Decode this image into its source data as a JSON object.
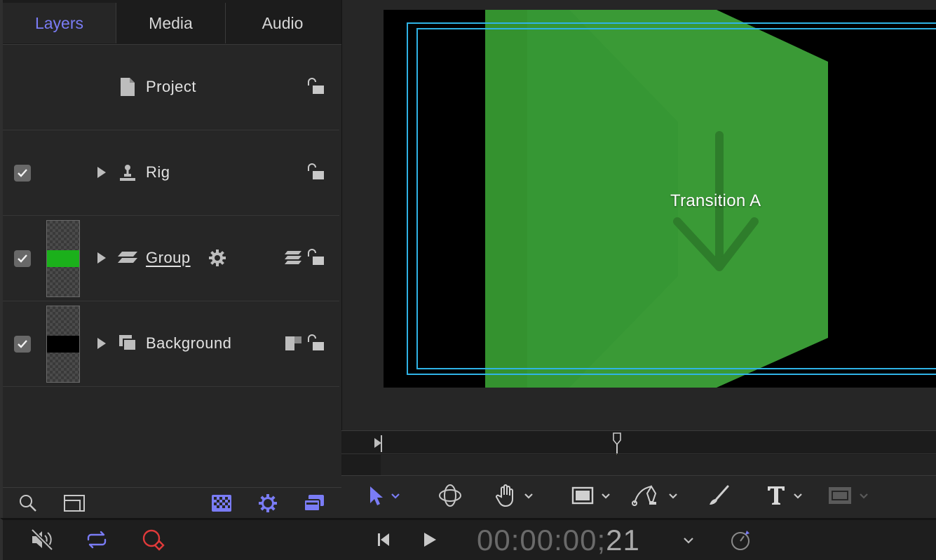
{
  "tabs": [
    {
      "label": "Layers",
      "active": true
    },
    {
      "label": "Media",
      "active": false
    },
    {
      "label": "Audio",
      "active": false
    }
  ],
  "layers": {
    "project": {
      "label": "Project",
      "icon": "document-icon"
    },
    "rig": {
      "label": "Rig",
      "icon": "rig-joystick-icon",
      "enabled": true
    },
    "group": {
      "label": "Group",
      "icon": "group-layers-icon",
      "enabled": true,
      "thumbnail_color": "#1bb01b"
    },
    "background": {
      "label": "Background",
      "icon": "stacked-squares-icon",
      "enabled": true,
      "thumbnail_color": "#000000"
    }
  },
  "canvas": {
    "label": "Transition A",
    "shape_color": "#3a9a36",
    "guide_color": "#2fb3e6"
  },
  "toolbar": {
    "tools": [
      "select-arrow-icon",
      "3d-orbit-icon",
      "hand-pan-icon",
      "rectangle-icon",
      "bezier-pen-icon",
      "paint-brush-icon",
      "text-icon",
      "shape-mask-icon"
    ]
  },
  "transport": {
    "timecode_dim": "00:00:00;",
    "timecode_frames": "21"
  },
  "colors": {
    "accent": "#7a7cf5",
    "record": "#e03a3a"
  }
}
